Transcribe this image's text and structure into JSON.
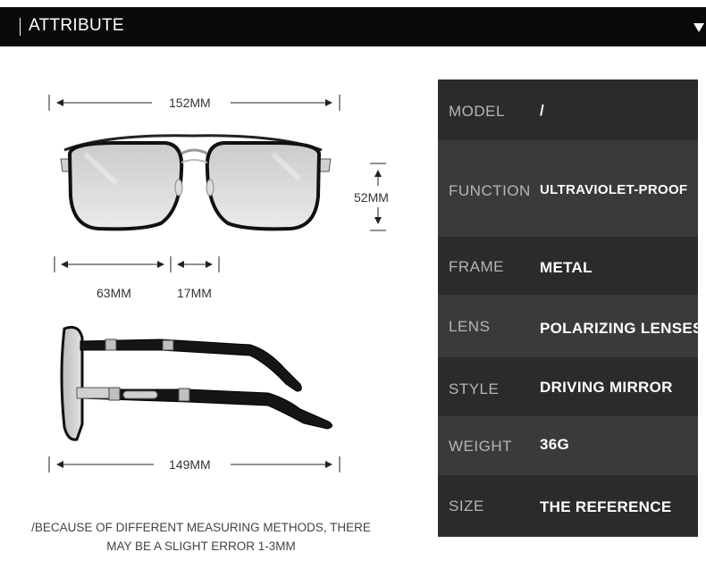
{
  "header": {
    "title": "ATTRIBUTE"
  },
  "dimensions": {
    "total_width": "152MM",
    "lens_height": "52MM",
    "lens_width": "63MM",
    "bridge": "17MM",
    "temple_length": "149MM"
  },
  "note": {
    "line1": "/BECAUSE OF DIFFERENT MEASURING METHODS, THERE",
    "line2": "MAY BE A SLIGHT ERROR 1-3MM"
  },
  "specs": [
    {
      "label": "MODEL",
      "value": "/"
    },
    {
      "label": "FUNCTION",
      "value": "ULTRAVIOLET-PROOF"
    },
    {
      "label": "FRAME",
      "value": "METAL"
    },
    {
      "label": "LENS",
      "value": "POLARIZING LENSES"
    },
    {
      "label": "STYLE",
      "value": "DRIVING MIRROR"
    },
    {
      "label": "WEIGHT",
      "value": "36G"
    },
    {
      "label": "SIZE",
      "value": "THE REFERENCE"
    }
  ],
  "colors": {
    "header_bg": "#0a0a0a",
    "panel_dark": "#2b2b2b",
    "panel_light": "#3a3a3a"
  }
}
